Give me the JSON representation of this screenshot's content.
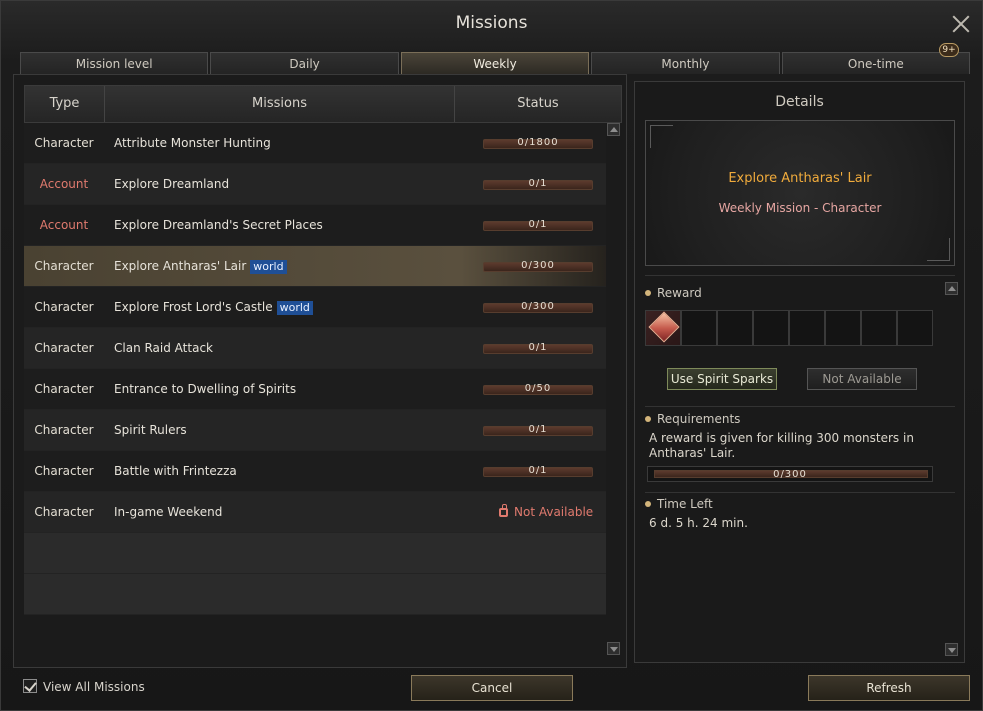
{
  "window": {
    "title": "Missions"
  },
  "tabs": [
    {
      "label": "Mission level"
    },
    {
      "label": "Daily"
    },
    {
      "label": "Weekly",
      "active": true
    },
    {
      "label": "Monthly"
    },
    {
      "label": "One-time",
      "badge": "9+"
    }
  ],
  "table": {
    "headers": {
      "type": "Type",
      "missions": "Missions",
      "status": "Status"
    },
    "rows": [
      {
        "type": "Character",
        "name": "Attribute Monster Hunting",
        "status": "0/1800"
      },
      {
        "type": "Account",
        "name": "Explore Dreamland",
        "status": "0/1"
      },
      {
        "type": "Account",
        "name": "Explore Dreamland's Secret Places",
        "status": "0/1"
      },
      {
        "type": "Character",
        "name": "Explore Antharas' Lair",
        "tag": "world",
        "status": "0/300",
        "selected": true
      },
      {
        "type": "Character",
        "name": "Explore Frost Lord's Castle",
        "tag": "world",
        "status": "0/300"
      },
      {
        "type": "Character",
        "name": "Clan Raid Attack",
        "status": "0/1"
      },
      {
        "type": "Character",
        "name": "Entrance to Dwelling of Spirits",
        "status": "0/50"
      },
      {
        "type": "Character",
        "name": "Spirit Rulers",
        "status": "0/1"
      },
      {
        "type": "Character",
        "name": "Battle with Frintezza",
        "status": "0/1"
      },
      {
        "type": "Character",
        "name": "In-game Weekend",
        "status": "Not Available",
        "locked": true
      }
    ]
  },
  "details": {
    "title": "Details",
    "mission_name": "Explore Antharas' Lair",
    "mission_sub": "Weekly Mission  -  Character",
    "reward_label": "Reward",
    "use_spirit_label": "Use Spirit Sparks",
    "not_available_label": "Not Available",
    "requirements_label": "Requirements",
    "requirements_text": "A reward is given for killing 300 monsters in Antharas' Lair.",
    "requirements_progress": "0/300",
    "time_left_label": "Time Left",
    "time_left_value": "6 d. 5 h. 24 min."
  },
  "footer": {
    "view_all_label": "View All Missions",
    "cancel_label": "Cancel",
    "refresh_label": "Refresh"
  },
  "icons": {
    "close": "close-icon",
    "lock": "lock-icon",
    "reward_gem": "reward-item-icon"
  }
}
